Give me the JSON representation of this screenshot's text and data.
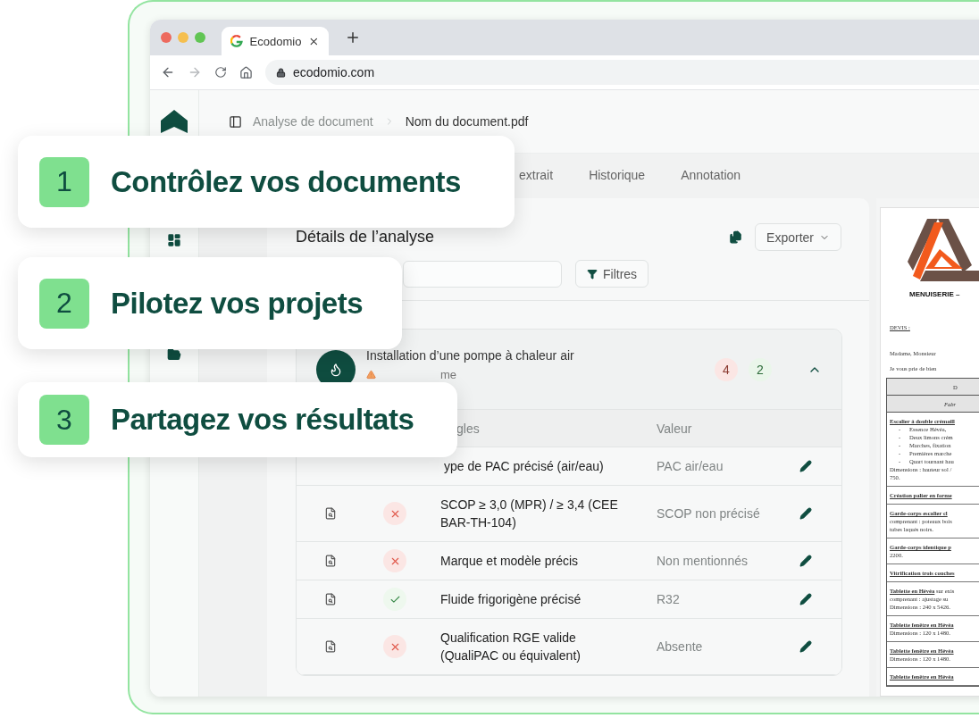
{
  "browser": {
    "tab_title": "Ecodomio",
    "url": "ecodomio.com"
  },
  "breadcrumb": [
    {
      "label": "Analyse de document",
      "current": false
    },
    {
      "label": "Nom du document.pdf",
      "current": true
    }
  ],
  "tabs": [
    {
      "label": "extrait",
      "selected": false
    },
    {
      "label": "Historique",
      "selected": false
    },
    {
      "label": "Annotation",
      "selected": false
    }
  ],
  "analysis": {
    "title": "Détails de l’analyse",
    "export_button": "Exporter",
    "filter_button": "Filtres",
    "group": {
      "title": "Installation d’une pompe à chaleur air",
      "subtitle": "me",
      "fail_count": "4",
      "pass_count": "2",
      "expanded": true,
      "columns": [
        "gles",
        "Valeur"
      ],
      "rows": [
        {
          "rule": "ype de PAC précisé (air/eau)",
          "value": "PAC air/eau"
        },
        {
          "rule": "SCOP ≥ 3,0 (MPR) / ≥ 3,4 (CEE BAR-TH-104)",
          "value": "SCOP non précisé",
          "passed": false
        },
        {
          "rule": "Marque et modèle précis",
          "value": "Non mentionnés",
          "passed": false
        },
        {
          "rule": "Fluide frigorigène précisé",
          "value": "R32",
          "passed": true
        },
        {
          "rule": "Qualification RGE valide (QualiPAC ou équivalent)",
          "value": "Absente",
          "passed": false
        }
      ]
    }
  },
  "document": {
    "company": "MENUISERIE –",
    "label": "DEVIS :",
    "salutation": "Madame, Monsieur",
    "intro": "Je vous prie de bien",
    "table_title": "D",
    "table_subtitle": "Fabr",
    "sections": [
      {
        "title": "Escalier à double crémaill",
        "bullets": [
          {
            "marker": "-",
            "text": "Essence Hévéa,"
          },
          {
            "marker": "-",
            "text": "Deux limons crém"
          },
          {
            "marker": "-",
            "text": "Marches, fixation"
          },
          {
            "marker": "-",
            "text": "Premières marche"
          },
          {
            "marker": "-",
            "text": "Quart tournant hau"
          }
        ],
        "lines": [
          "Dimensions : hauteur sol /",
          "750."
        ]
      },
      {
        "title": "Création palier en forme"
      },
      {
        "title": "Garde-corps escalier cl",
        "lines": [
          "comprenant : poteaux bois",
          "tubes laqués noirs."
        ]
      },
      {
        "title": "Garde-corps identique p",
        "lines": [
          "2200."
        ]
      },
      {
        "title": "Vitrification trois couches"
      },
      {
        "title": "Tablette en Hévéa",
        "continuation": "sur exis",
        "lines": [
          "comprenant : ajustage su",
          "Dimensions : 240 x 5426."
        ]
      },
      {
        "title": "Tablette fenêtre en Hévéa",
        "lines": [
          "Dimensions : 120 x 1480."
        ]
      },
      {
        "title": "Tablette fenêtre en Hévéa",
        "lines": [
          "Dimensions : 120 x 1480."
        ]
      },
      {
        "title": "Tablette fenêtre en Hévéa"
      }
    ]
  },
  "callouts": [
    {
      "number": "1",
      "text": "Contrôlez vos documents"
    },
    {
      "number": "2",
      "text": "Pilotez vos projets"
    },
    {
      "number": "3",
      "text": "Partagez vos résultats"
    }
  ]
}
